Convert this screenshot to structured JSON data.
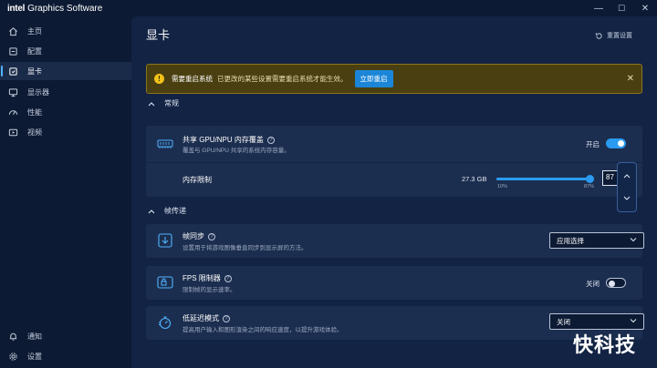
{
  "app": {
    "brand_intel": "intel",
    "brand_rest": "Graphics Software"
  },
  "window_controls": {
    "minimize": "—",
    "maximize": "☐",
    "close": "✕"
  },
  "sidebar": {
    "items": [
      {
        "label": "主页",
        "icon": "home-icon"
      },
      {
        "label": "配置",
        "icon": "layers-icon"
      },
      {
        "label": "显卡",
        "icon": "gpu-chip-icon",
        "active": true
      },
      {
        "label": "显示器",
        "icon": "monitor-icon"
      },
      {
        "label": "性能",
        "icon": "speedometer-icon"
      },
      {
        "label": "视频",
        "icon": "video-icon"
      }
    ],
    "bottom": [
      {
        "label": "通知",
        "icon": "bell-icon"
      },
      {
        "label": "设置",
        "icon": "gear-icon"
      }
    ]
  },
  "page": {
    "title": "显卡",
    "reset_label": "重置设置"
  },
  "alert": {
    "title": "需要重启系统",
    "message": "已更改的某些设置需要重启系统才能生效。",
    "action_label": "立即重启",
    "close": "✕"
  },
  "sections": {
    "general": {
      "title": "常规",
      "shared_memory": {
        "title": "共享 GPU/NPU 内存覆盖",
        "subtitle": "覆盖与 GPU/NPU 共享的系统内存容量。",
        "toggle_label": "开启",
        "toggle_on": true
      },
      "memory_limit": {
        "label": "内存限制",
        "value_text": "27.3 GB",
        "slider_min_label": "10%",
        "slider_max_label": "87%",
        "slider_value_percent": 87,
        "input_value": "87"
      }
    },
    "frame_delivery": {
      "title": "帧传递",
      "vsync": {
        "title": "帧同步",
        "subtitle": "设置用于将游戏图像垂直同步到显示屏的方法。",
        "dropdown_value": "应用选择"
      },
      "fps_limiter": {
        "title": "FPS 限制器",
        "subtitle": "限制帧的显示速率。",
        "toggle_label": "关闭",
        "toggle_on": false
      },
      "low_latency": {
        "title": "低延迟模式",
        "subtitle": "提高用户输入和图形渲染之间的响应速度，以提升游戏体验。",
        "dropdown_value": "关闭"
      }
    }
  },
  "help_glyph": "?",
  "watermark": "快科技",
  "colors": {
    "accent": "#2a9bf0",
    "alert_bg": "#4a3f10",
    "alert_icon": "#f2c21b",
    "background": "#0d1a33",
    "panel": "#122344",
    "card": "#1c2e4f"
  }
}
